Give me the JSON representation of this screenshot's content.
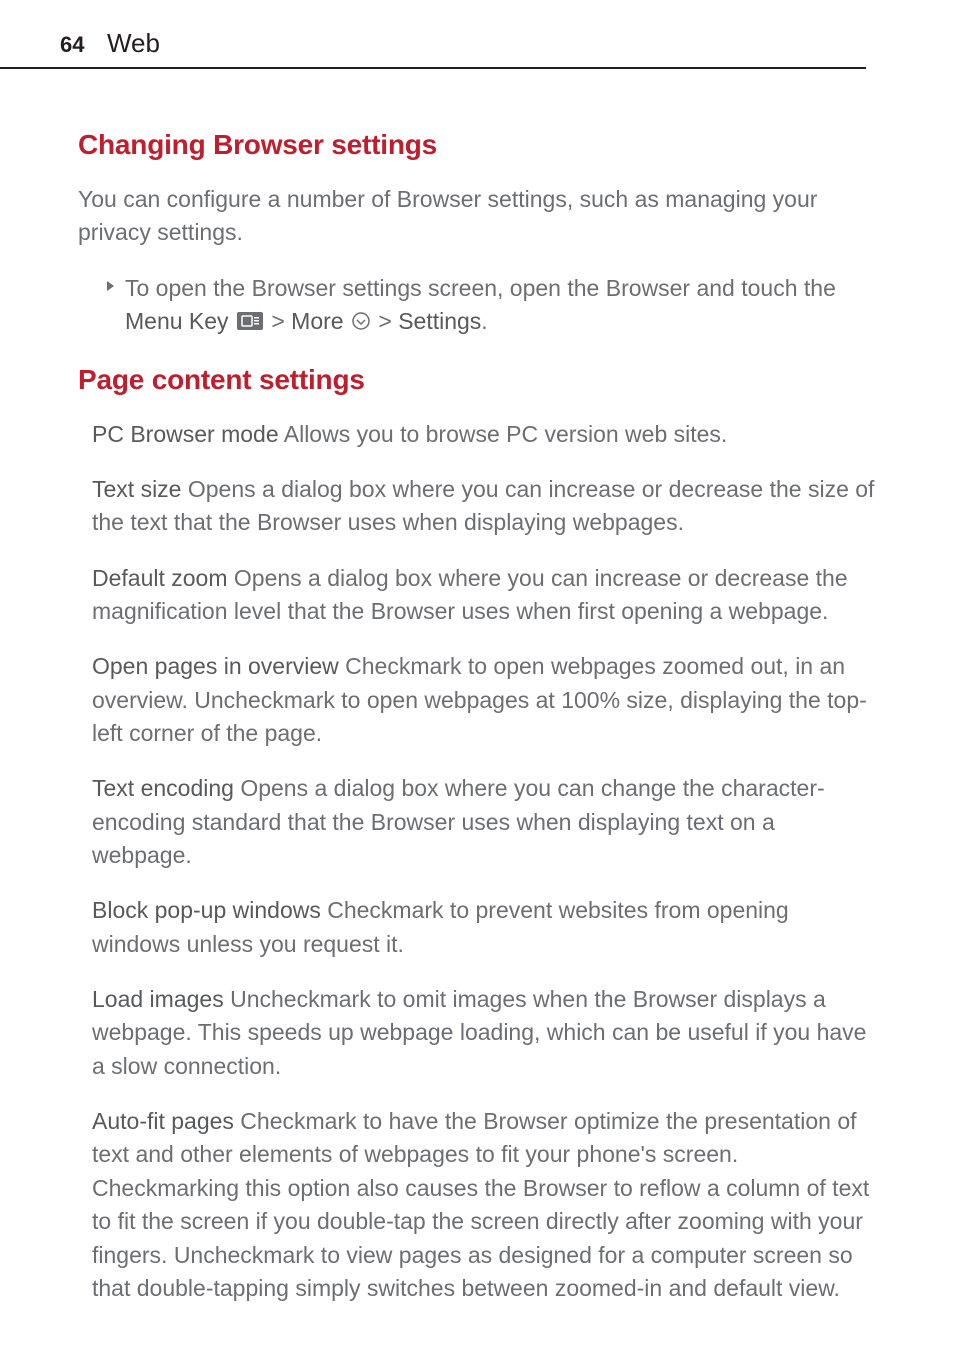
{
  "page": {
    "number": "64",
    "section": "Web"
  },
  "h1": "Changing Browser settings",
  "intro": "You can configure a number of Browser settings, such as managing your privacy settings.",
  "bullet": {
    "pre": "To open the Browser settings screen, open the Browser and touch the ",
    "menu_key": "Menu Key",
    "gt1": " > ",
    "more": "More",
    "gt2": " > ",
    "settings": "Settings",
    "dot": "."
  },
  "h2": "Page content settings",
  "settings": {
    "pc_browser": {
      "label": "PC Browser mode",
      "desc": " Allows you to browse PC version web sites."
    },
    "text_size": {
      "label": "Text size",
      "desc": " Opens a dialog box where you can increase or decrease the size of the text that the Browser uses when displaying webpages."
    },
    "default_zoom": {
      "label": "Default zoom",
      "desc": " Opens a dialog box where you can increase or decrease the magnification level that the Browser uses when first opening a webpage."
    },
    "open_overview": {
      "label": "Open pages in overview",
      "desc": " Checkmark to open webpages zoomed out, in an overview. Uncheckmark to open webpages at 100% size, displaying the top-left corner of the page."
    },
    "text_encoding": {
      "label": "Text encoding",
      "desc": " Opens a dialog box where you can change the character-encoding standard that the Browser uses when displaying text on a webpage."
    },
    "block_popup": {
      "label": "Block pop-up windows",
      "desc": " Checkmark to prevent websites from opening windows unless you request it."
    },
    "load_images": {
      "label": "Load images",
      "desc": " Uncheckmark to omit images when the Browser displays a webpage. This speeds up webpage loading, which can be useful if you have a slow connection."
    },
    "autofit": {
      "label": "Auto-fit pages",
      "desc": " Checkmark to have the Browser optimize the presentation of text and other elements of webpages to fit your phone's screen. Checkmarking this option also causes the Browser to reflow a column of text to fit the screen if you double-tap the screen directly after zooming with your fingers. Uncheckmark to view pages as designed for a computer screen so that double-tapping simply switches between zoomed-in and default view."
    }
  }
}
